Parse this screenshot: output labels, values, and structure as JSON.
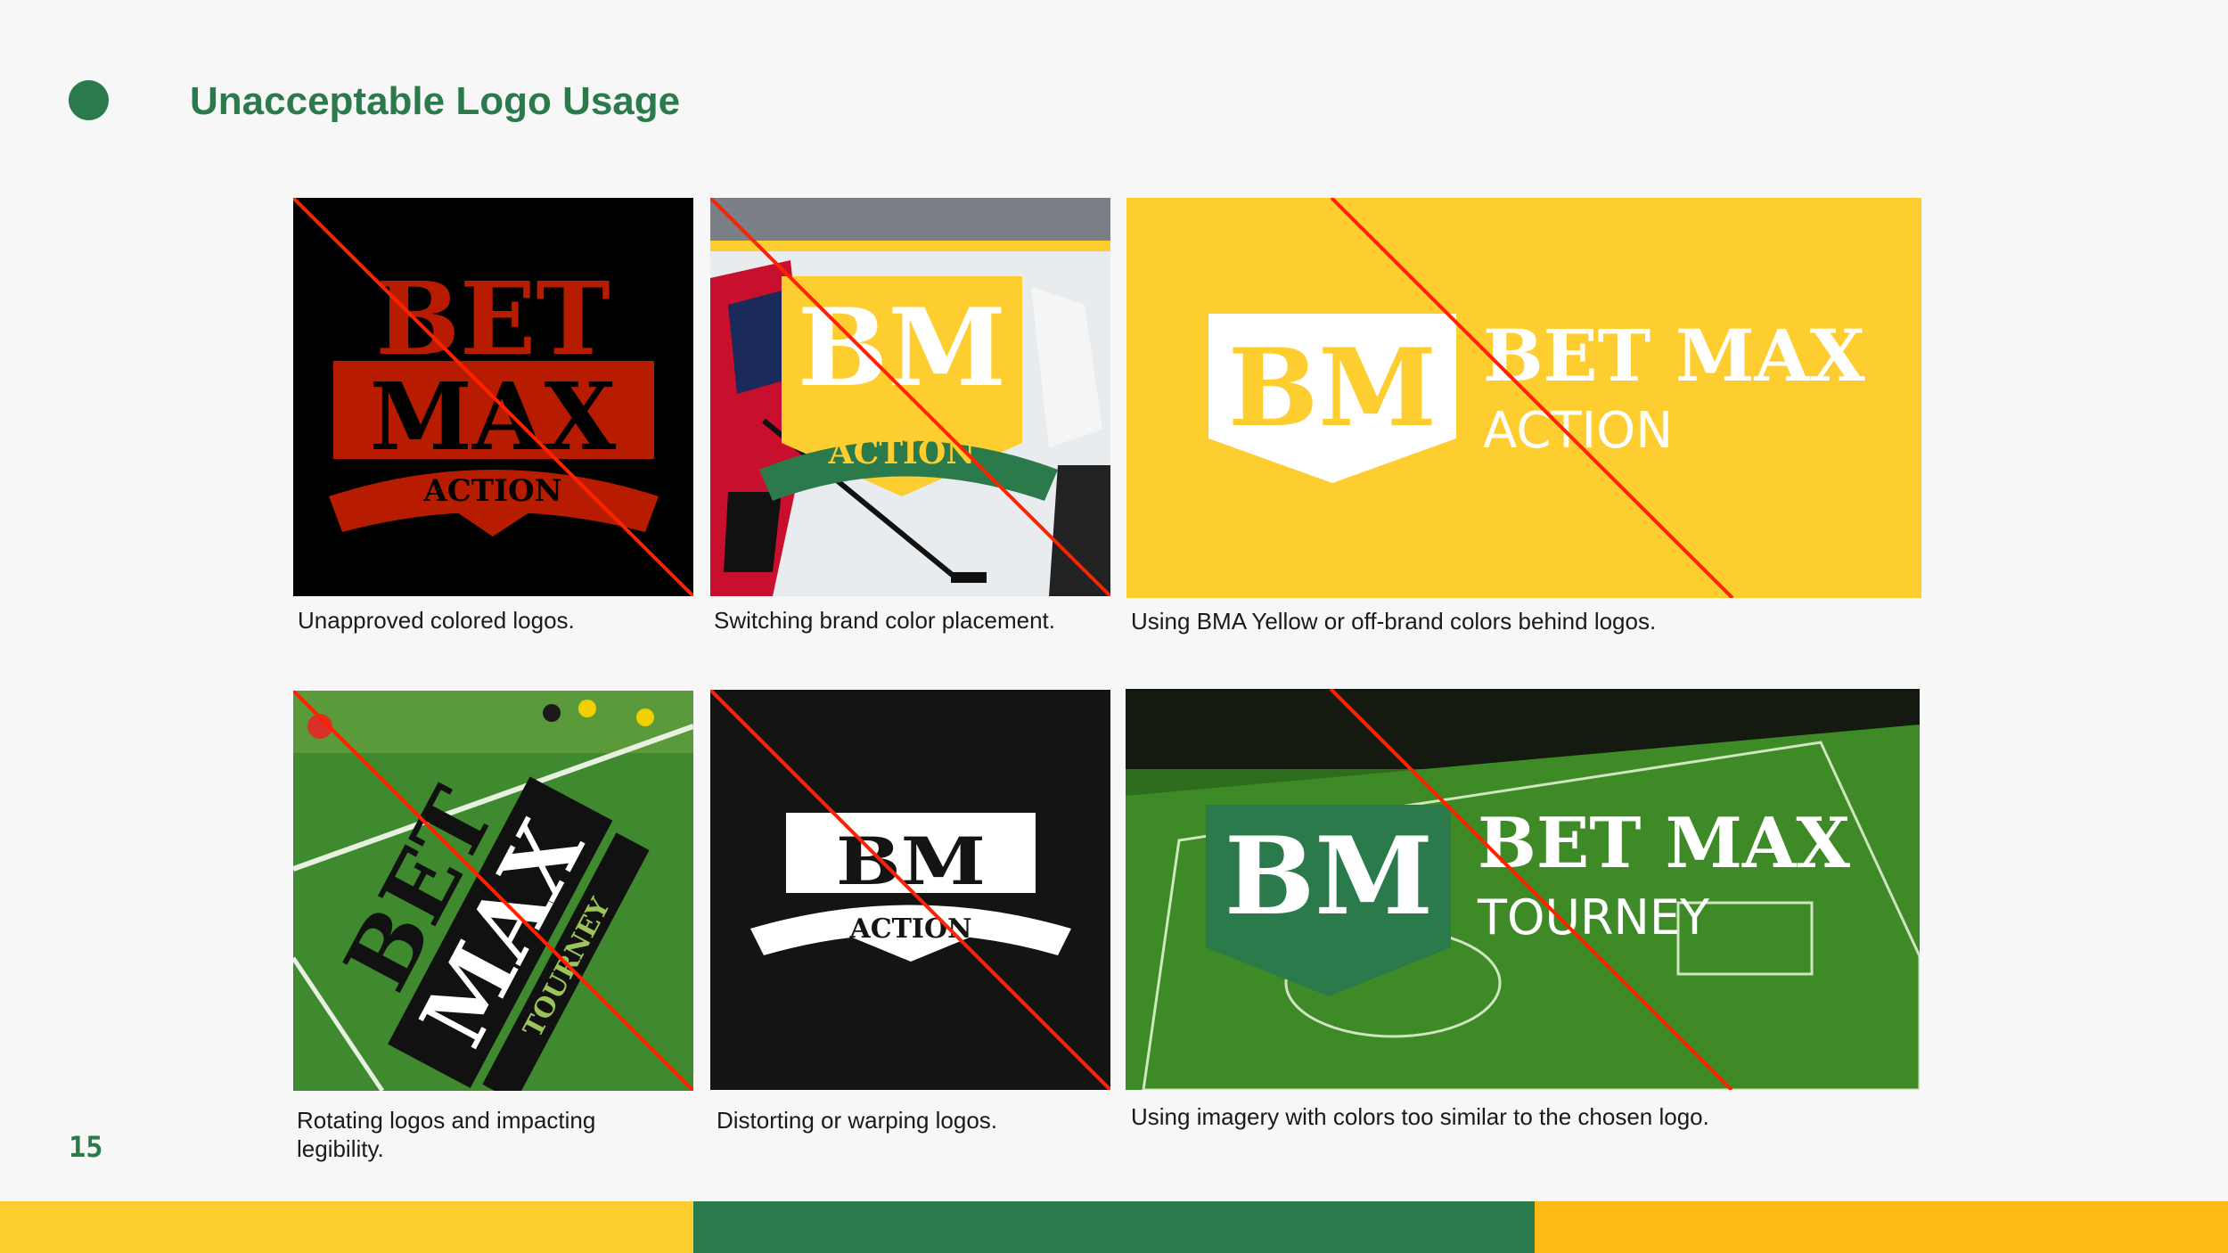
{
  "page": {
    "title": "Unacceptable Logo Usage",
    "page_number": "15",
    "colors": {
      "brand_green": "#2b7a4b",
      "brand_yellow": "#fecd30",
      "accent_gold": "#fdb914",
      "strike_red": "#ff2200",
      "background": "#f7f7f7"
    }
  },
  "examples": [
    {
      "caption": "Unapproved colored logos.",
      "logo": {
        "line1": "BET",
        "line2": "MAX",
        "banner": "ACTION"
      }
    },
    {
      "caption": "Switching brand color placement.",
      "logo": {
        "mark": "BM",
        "banner": "ACTION"
      }
    },
    {
      "caption": "Using BMA Yellow or off-brand colors behind logos.",
      "logo": {
        "mark": "BM",
        "name": "BET MAX",
        "sub": "ACTION"
      }
    },
    {
      "caption": "Rotating logos and impacting legibility.",
      "logo": {
        "line1": "BET",
        "line2": "MAX",
        "banner": "TOURNEY"
      }
    },
    {
      "caption": "Distorting or warping logos.",
      "logo": {
        "mark": "BM",
        "banner": "ACTION"
      }
    },
    {
      "caption": "Using imagery with colors too similar to the chosen logo.",
      "logo": {
        "mark": "BM",
        "name": "BET MAX",
        "sub": "TOURNEY"
      }
    }
  ],
  "footer": {
    "segments": [
      "yellow",
      "green",
      "gold"
    ]
  }
}
